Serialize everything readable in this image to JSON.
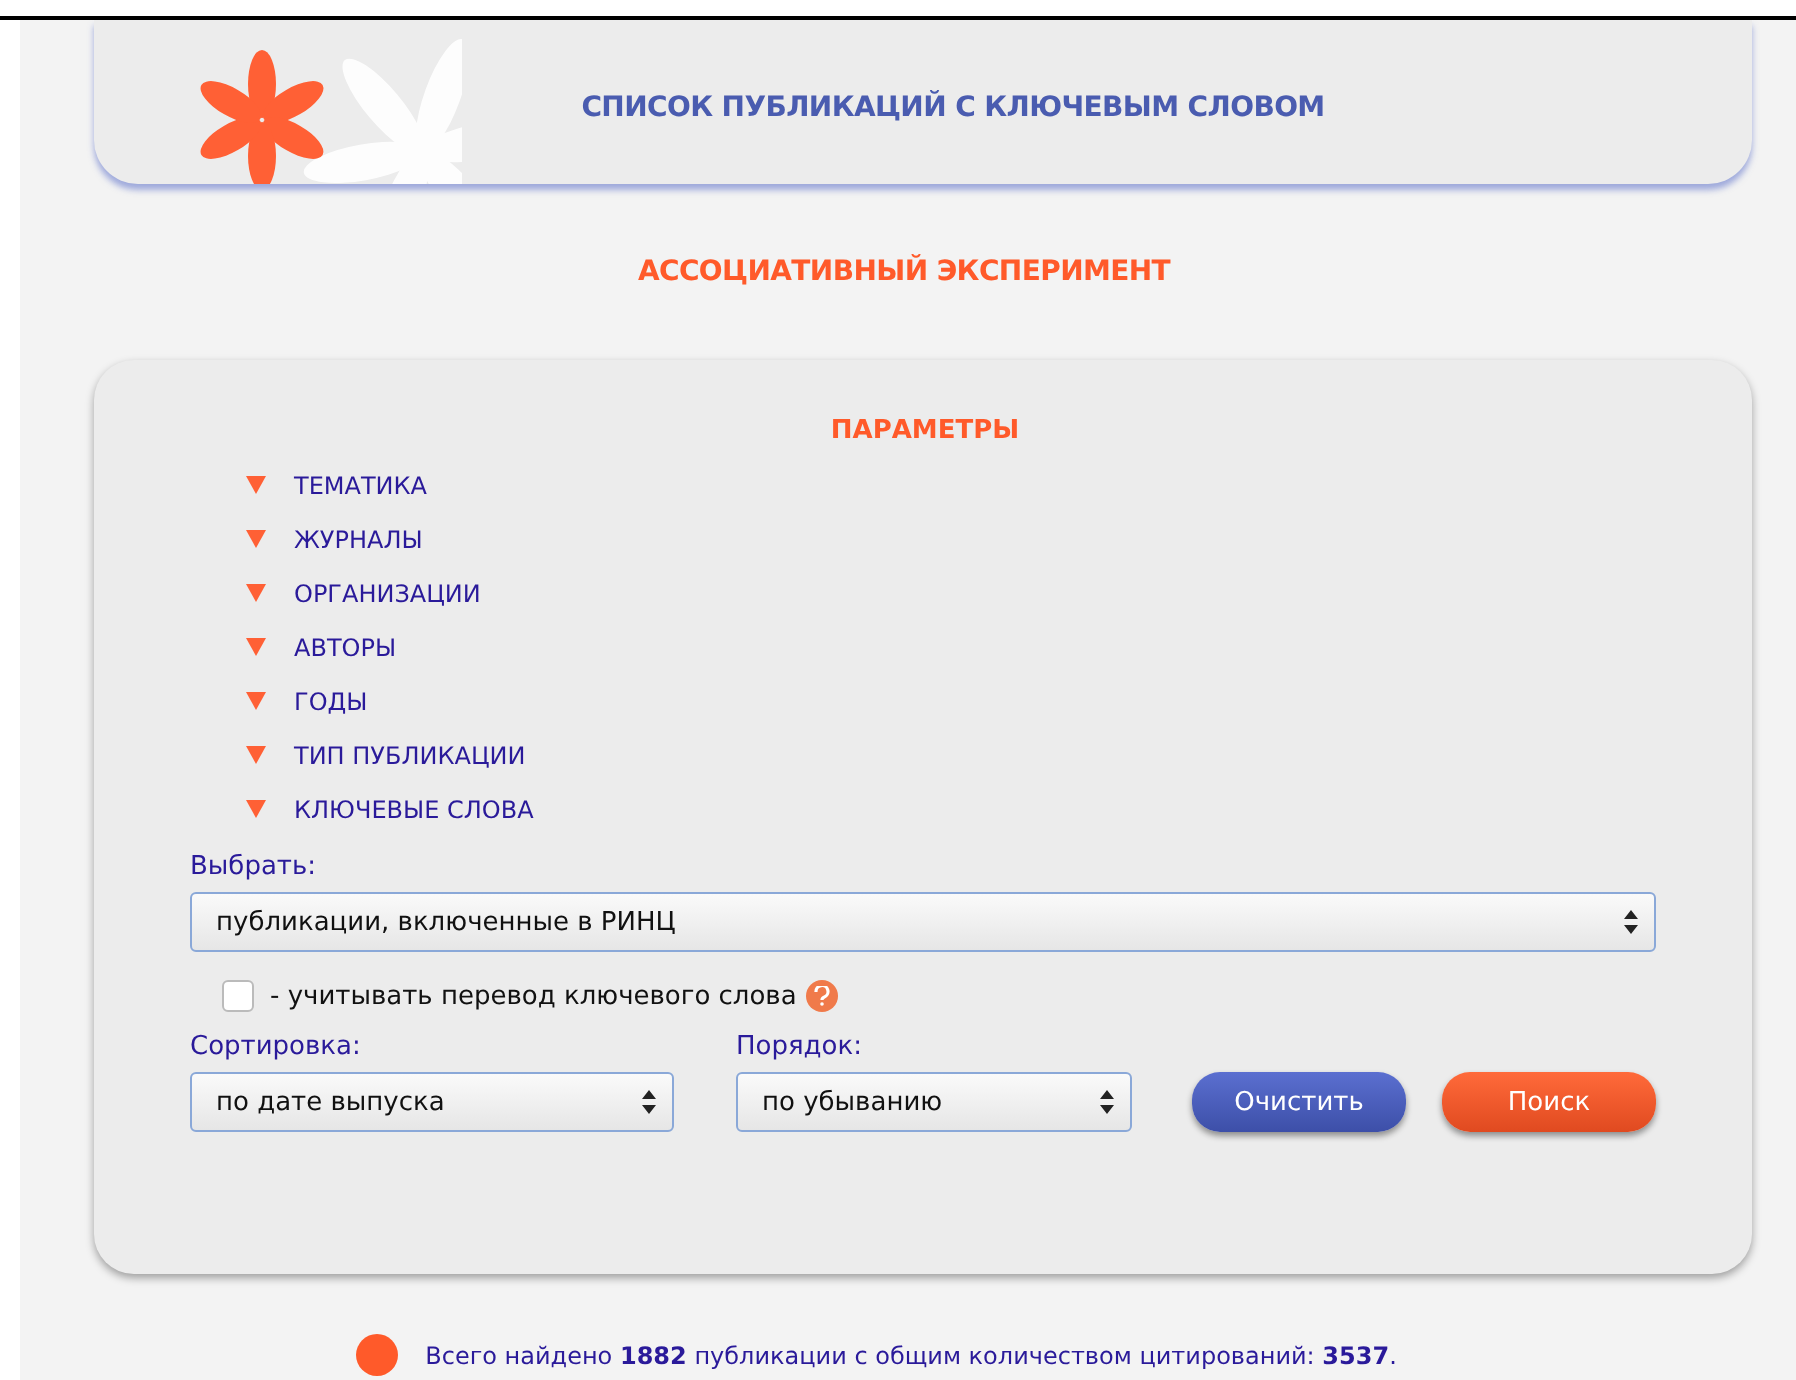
{
  "header": {
    "title": "СПИСОК ПУБЛИКАЦИЙ С КЛЮЧЕВЫМ СЛОВОМ"
  },
  "keyword": "АССОЦИАТИВНЫЙ ЭКСПЕРИМЕНТ",
  "parameters": {
    "title": "ПАРАМЕТРЫ",
    "sections": [
      {
        "label": "ТЕМАТИКА"
      },
      {
        "label": "ЖУРНАЛЫ"
      },
      {
        "label": "ОРГАНИЗАЦИИ"
      },
      {
        "label": "АВТОРЫ"
      },
      {
        "label": "ГОДЫ"
      },
      {
        "label": "ТИП ПУБЛИКАЦИИ"
      },
      {
        "label": "КЛЮЧЕВЫЕ СЛОВА"
      }
    ],
    "select": {
      "label": "Выбрать:",
      "value": "публикации, включенные в РИНЦ"
    },
    "translate": {
      "label": "- учитывать перевод ключевого слова",
      "checked": false
    },
    "sort": {
      "label": "Сортировка:",
      "value": "по дате выпуска"
    },
    "order": {
      "label": "Порядок:",
      "value": "по убыванию"
    },
    "buttons": [
      {
        "label": "Очистить",
        "kind": "clear"
      },
      {
        "label": "Поиск",
        "kind": "search"
      }
    ]
  },
  "summary": "Всего найдено **1882** публикации с общим количеством цитирований: **3537**."
}
